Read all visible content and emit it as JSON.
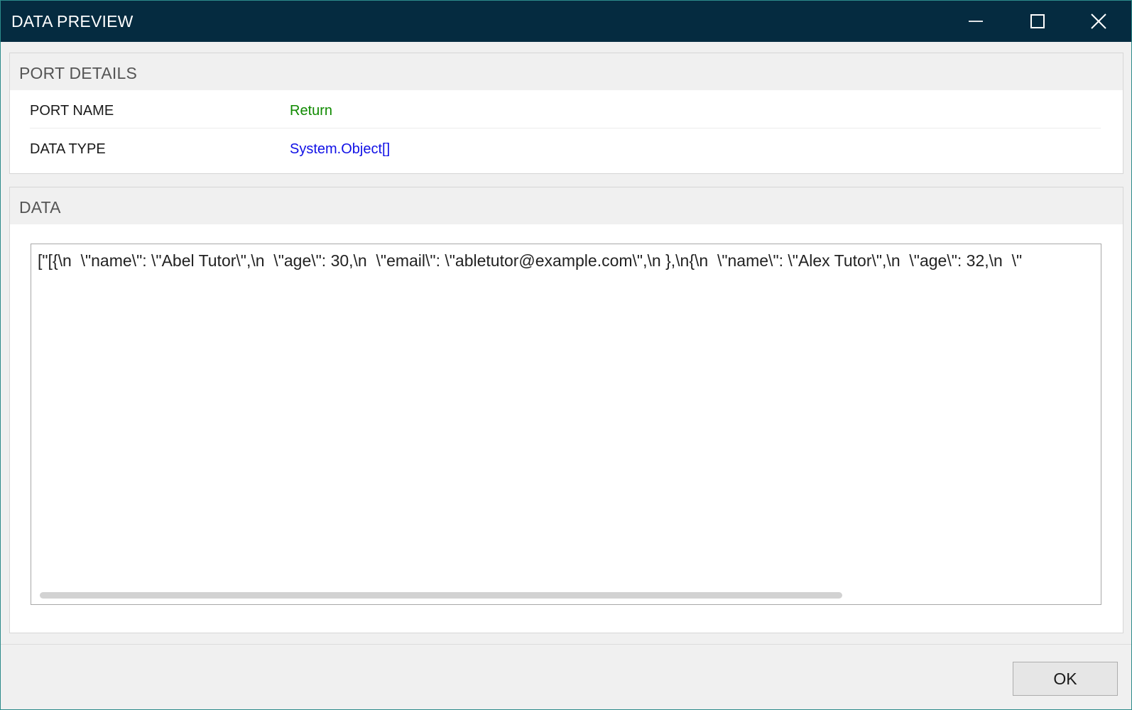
{
  "window": {
    "title": "DATA PREVIEW",
    "controls": {
      "minimize_icon": "minimize-icon",
      "maximize_icon": "maximize-icon",
      "close_icon": "close-icon"
    },
    "colors": {
      "titlebar": "#052b40",
      "background": "#f0f0f0"
    }
  },
  "port_details": {
    "header": "PORT DETAILS",
    "rows": [
      {
        "label": "PORT NAME",
        "value": "Return",
        "color": "#0f8a00"
      },
      {
        "label": "DATA TYPE",
        "value": "System.Object[]",
        "color": "#1010e6"
      }
    ]
  },
  "data_section": {
    "header": "DATA",
    "content": "[\"[{\\n  \\\"name\\\": \\\"Abel Tutor\\\",\\n  \\\"age\\\": 30,\\n  \\\"email\\\": \\\"abletutor@example.com\\\",\\n },\\n{\\n  \\\"name\\\": \\\"Alex Tutor\\\",\\n  \\\"age\\\": 32,\\n  \\\""
  },
  "footer": {
    "ok_label": "OK"
  }
}
